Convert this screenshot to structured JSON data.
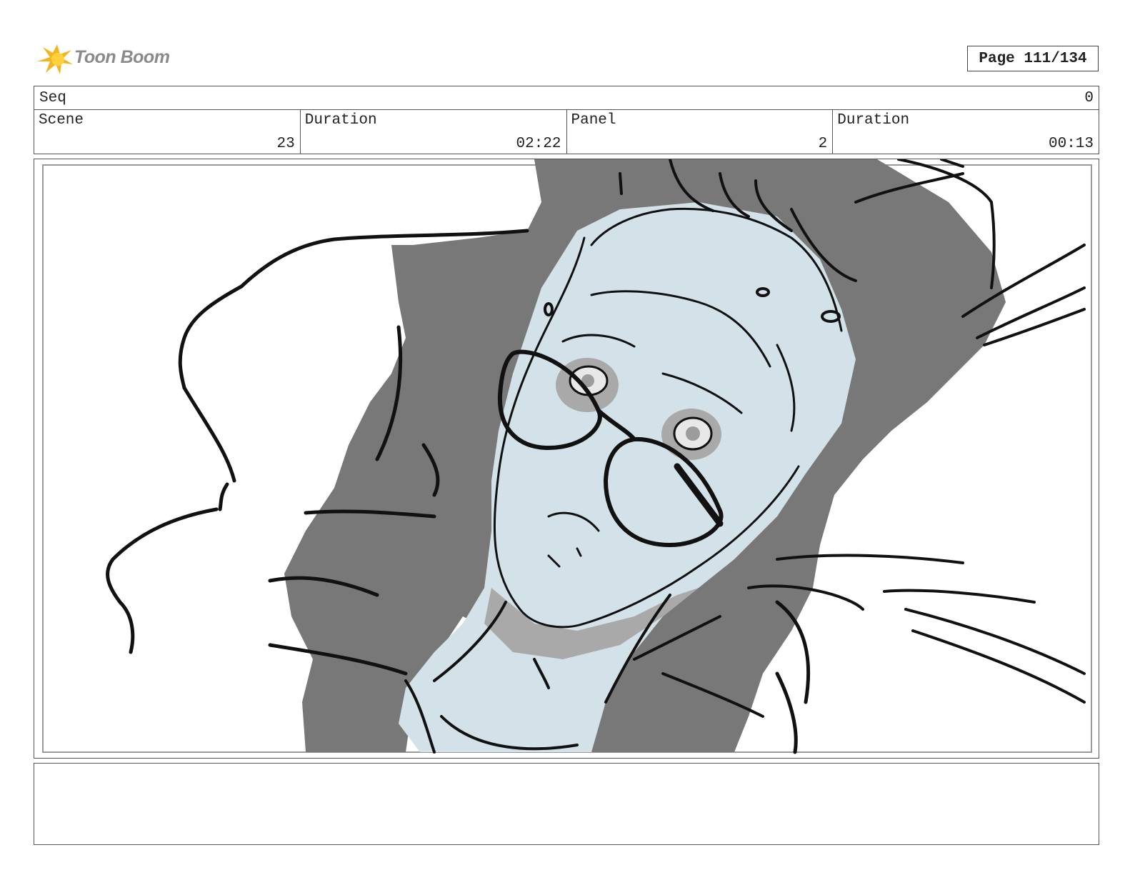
{
  "header": {
    "logo_text": "Toon Boom",
    "page_label": "Page 111/134"
  },
  "meta": {
    "seq_label": "Seq",
    "seq_value": "0",
    "scene_label": "Scene",
    "scene_value": "23",
    "scene_duration_label": "Duration",
    "scene_duration_value": "02:22",
    "panel_label": "Panel",
    "panel_value": "2",
    "panel_duration_label": "Duration",
    "panel_duration_value": "00:13"
  },
  "colors": {
    "skin": "#d3e2e8",
    "dark": "#787878",
    "shadow": "#a9a9a9",
    "line": "#111111"
  },
  "notes": {
    "text": ""
  }
}
